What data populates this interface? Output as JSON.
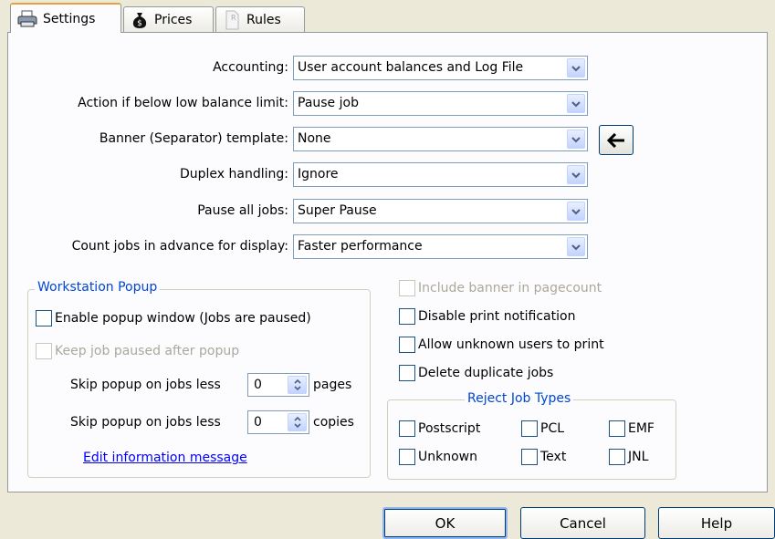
{
  "tabs": [
    {
      "label": "Settings",
      "icon": "printer-icon"
    },
    {
      "label": "Prices",
      "icon": "money-bag-icon"
    },
    {
      "label": "Rules",
      "icon": "rules-document-icon"
    }
  ],
  "settings": {
    "accounting": {
      "label": "Accounting:",
      "value": "User account balances and Log File"
    },
    "low_balance": {
      "label": "Action if below low balance limit:",
      "value": "Pause job"
    },
    "banner": {
      "label": "Banner (Separator) template:",
      "value": "None"
    },
    "duplex": {
      "label": "Duplex handling:",
      "value": "Ignore"
    },
    "pause_all": {
      "label": "Pause all jobs:",
      "value": "Super Pause"
    },
    "count_jobs": {
      "label": "Count jobs in advance for display:",
      "value": "Faster performance"
    }
  },
  "workstation_popup": {
    "legend": "Workstation Popup",
    "enable_popup": "Enable popup window  (Jobs are paused)",
    "keep_paused": "Keep job paused after popup",
    "skip_pages": {
      "label": "Skip popup on jobs less",
      "value": "0",
      "unit": "pages"
    },
    "skip_copies": {
      "label": "Skip popup on jobs less",
      "value": "0",
      "unit": "copies"
    },
    "edit_link": "Edit information message"
  },
  "options": {
    "include_banner": "Include banner in pagecount",
    "disable_notification": "Disable print notification",
    "allow_unknown": "Allow unknown users to print",
    "delete_duplicates": "Delete duplicate jobs"
  },
  "reject_types": {
    "legend": "Reject Job Types",
    "items": [
      "Postscript",
      "PCL",
      "EMF",
      "Unknown",
      "Text",
      "JNL"
    ]
  },
  "buttons": {
    "ok": "OK",
    "cancel": "Cancel",
    "help": "Help"
  }
}
